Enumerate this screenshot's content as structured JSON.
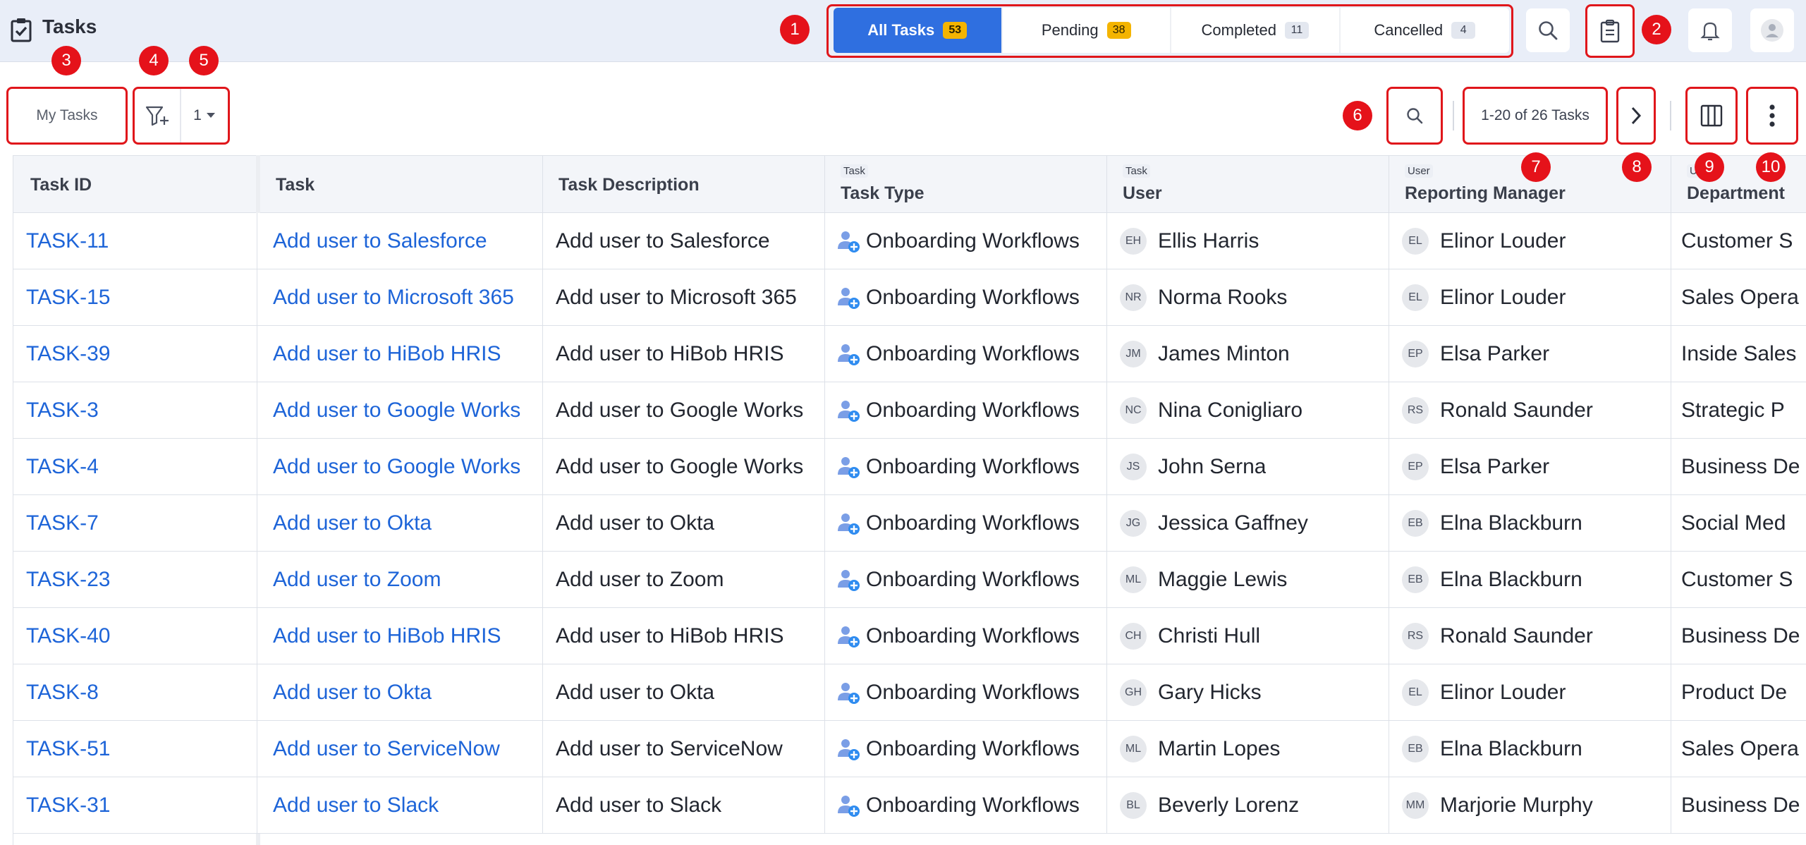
{
  "app": {
    "title": "Tasks"
  },
  "tabs": [
    {
      "label": "All Tasks",
      "count": "53",
      "active": true
    },
    {
      "label": "Pending",
      "count": "38",
      "active": false
    },
    {
      "label": "Completed",
      "count": "11",
      "active": false
    },
    {
      "label": "Cancelled",
      "count": "4",
      "active": false
    }
  ],
  "toolbar": {
    "view_label": "My Tasks",
    "filter_count": "1",
    "pager_text": "1-20 of 26 Tasks"
  },
  "markers": [
    "1",
    "2",
    "3",
    "4",
    "5",
    "6",
    "7",
    "8",
    "9",
    "10"
  ],
  "columns": {
    "task_id": "Task ID",
    "task": "Task",
    "description": "Task Description",
    "task_type_tag": "Task",
    "task_type": "Task Type",
    "user_tag": "Task",
    "user": "User",
    "manager_tag": "User",
    "manager": "Reporting Manager",
    "department_tag": "U",
    "department": "Department"
  },
  "rows": [
    {
      "id": "TASK-11",
      "task": "Add user to Salesforce",
      "desc": "Add user to Salesforce",
      "type": "Onboarding Workflows",
      "user_initials": "EH",
      "user": "Ellis Harris",
      "mgr_initials": "EL",
      "mgr": "Elinor Louder",
      "dept": "Customer S"
    },
    {
      "id": "TASK-15",
      "task": "Add user to Microsoft 365",
      "desc": "Add user to Microsoft 365",
      "type": "Onboarding Workflows",
      "user_initials": "NR",
      "user": "Norma Rooks",
      "mgr_initials": "EL",
      "mgr": "Elinor Louder",
      "dept": "Sales Opera"
    },
    {
      "id": "TASK-39",
      "task": "Add user to HiBob HRIS",
      "desc": "Add user to HiBob HRIS",
      "type": "Onboarding Workflows",
      "user_initials": "JM",
      "user": "James Minton",
      "mgr_initials": "EP",
      "mgr": "Elsa Parker",
      "dept": "Inside Sales"
    },
    {
      "id": "TASK-3",
      "task": "Add user to Google Works",
      "desc": "Add user to Google Works",
      "type": "Onboarding Workflows",
      "user_initials": "NC",
      "user": "Nina Conigliaro",
      "mgr_initials": "RS",
      "mgr": "Ronald Saunder",
      "dept": "Strategic P"
    },
    {
      "id": "TASK-4",
      "task": "Add user to Google Works",
      "desc": "Add user to Google Works",
      "type": "Onboarding Workflows",
      "user_initials": "JS",
      "user": "John Serna",
      "mgr_initials": "EP",
      "mgr": "Elsa Parker",
      "dept": "Business De"
    },
    {
      "id": "TASK-7",
      "task": "Add user to Okta",
      "desc": "Add user to Okta",
      "type": "Onboarding Workflows",
      "user_initials": "JG",
      "user": "Jessica Gaffney",
      "mgr_initials": "EB",
      "mgr": "Elna Blackburn",
      "dept": "Social Med"
    },
    {
      "id": "TASK-23",
      "task": "Add user to Zoom",
      "desc": "Add user to Zoom",
      "type": "Onboarding Workflows",
      "user_initials": "ML",
      "user": "Maggie Lewis",
      "mgr_initials": "EB",
      "mgr": "Elna Blackburn",
      "dept": "Customer S"
    },
    {
      "id": "TASK-40",
      "task": "Add user to HiBob HRIS",
      "desc": "Add user to HiBob HRIS",
      "type": "Onboarding Workflows",
      "user_initials": "CH",
      "user": "Christi Hull",
      "mgr_initials": "RS",
      "mgr": "Ronald Saunder",
      "dept": "Business De"
    },
    {
      "id": "TASK-8",
      "task": "Add user to Okta",
      "desc": "Add user to Okta",
      "type": "Onboarding Workflows",
      "user_initials": "GH",
      "user": "Gary Hicks",
      "mgr_initials": "EL",
      "mgr": "Elinor Louder",
      "dept": "Product De"
    },
    {
      "id": "TASK-51",
      "task": "Add user to ServiceNow",
      "desc": "Add user to ServiceNow",
      "type": "Onboarding Workflows",
      "user_initials": "ML",
      "user": "Martin Lopes",
      "mgr_initials": "EB",
      "mgr": "Elna Blackburn",
      "dept": "Sales Opera"
    },
    {
      "id": "TASK-31",
      "task": "Add user to Slack",
      "desc": "Add user to Slack",
      "type": "Onboarding Workflows",
      "user_initials": "BL",
      "user": "Beverly Lorenz",
      "mgr_initials": "MM",
      "mgr": "Marjorie Murphy",
      "dept": "Business De"
    }
  ],
  "colors": {
    "accent": "#2f6fe0",
    "link": "#1d64d8",
    "marker": "#e5121a",
    "badge_orange": "#f4b400",
    "topbar_bg": "#e9eef8"
  },
  "icons": {
    "app": "clipboard-check-icon",
    "search": "search-icon",
    "tasks": "clipboard-icon",
    "notifications": "bell-icon",
    "profile": "avatar-icon",
    "filter": "filter-add-icon",
    "caret": "caret-down-icon",
    "next": "chevron-right-icon",
    "columns": "columns-icon",
    "more": "more-vertical-icon",
    "task_type": "user-add-icon"
  }
}
